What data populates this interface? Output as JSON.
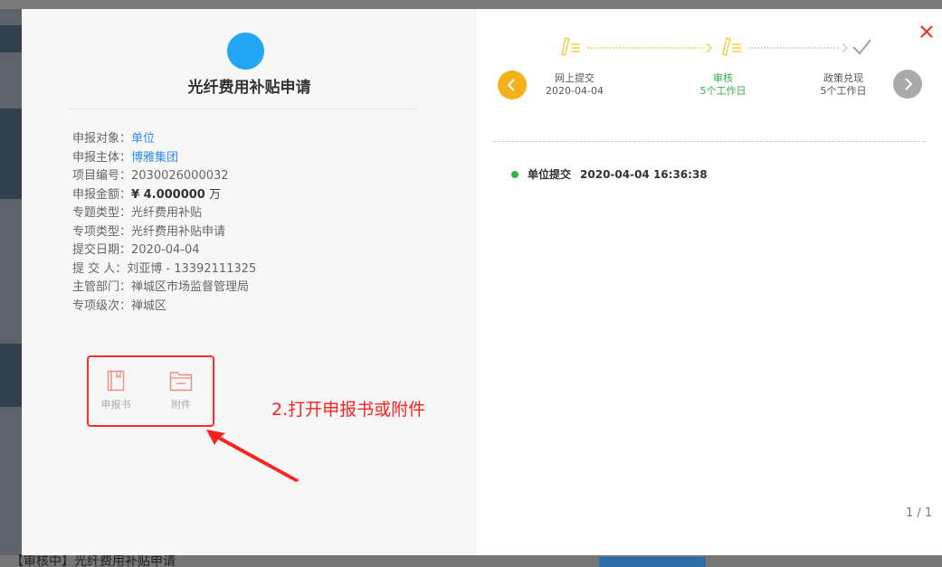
{
  "background": {
    "bottom_text": "【审核中】光纤费用补贴申请"
  },
  "application": {
    "title": "光纤费用补贴申请",
    "fields": [
      {
        "label": "申报对象：",
        "value": "单位"
      },
      {
        "label": "申报主体：",
        "value": "博雅集团"
      },
      {
        "label": "项目编号：",
        "value": "2030026000032"
      },
      {
        "label": "申报金额：",
        "value": "¥ 4.000000",
        "unit": " 万"
      },
      {
        "label": "专题类型：",
        "value": "光纤费用补贴"
      },
      {
        "label": "专项类型：",
        "value": "光纤费用补贴申请"
      },
      {
        "label": "提交日期：",
        "value": "2020-04-04"
      },
      {
        "label": "提 交 人：",
        "value": "刘亚博 - 13392111325"
      },
      {
        "label": "主管部门：",
        "value": "禅城区市场监督管理局"
      },
      {
        "label": "专项级次：",
        "value": "禅城区"
      }
    ],
    "attachments": [
      {
        "label": "申报书",
        "icon": "book-icon"
      },
      {
        "label": "附件",
        "icon": "folder-icon"
      }
    ]
  },
  "annotation": {
    "text": "2.打开申报书或附件",
    "color": "#ff2020"
  },
  "progress": {
    "steps": [
      {
        "name": "网上提交",
        "detail": "2020-04-04",
        "state": "done"
      },
      {
        "name": "审核",
        "detail": "5个工作日",
        "state": "active"
      },
      {
        "name": "政策兑现",
        "detail": "5个工作日",
        "state": "pending"
      }
    ],
    "prev_icon": "chevron-left-icon",
    "next_icon": "chevron-right-icon",
    "close_icon": "close-icon"
  },
  "log": [
    {
      "status": "单位提交",
      "time": "2020-04-04 16:36:38"
    }
  ],
  "pager": {
    "text": "1 / 1"
  },
  "colors": {
    "accent_blue": "#22a5f5",
    "link_blue": "#2d8cf0",
    "step_yellow": "#f5c518",
    "step_green": "#34b34a",
    "close_red": "#e8341c"
  }
}
